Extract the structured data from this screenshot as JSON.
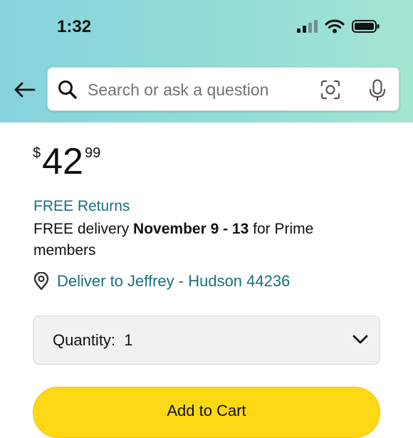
{
  "status_bar": {
    "time": "1:32"
  },
  "header": {
    "search": {
      "placeholder": "Search or ask a question"
    }
  },
  "product": {
    "price": {
      "symbol": "$",
      "whole": "42",
      "fraction": "99"
    },
    "free_returns": "FREE Returns",
    "delivery": {
      "prefix": "FREE delivery ",
      "dates": "November 9 - 13",
      "suffix": " for Prime members"
    },
    "deliver_to": "Deliver to Jeffrey - Hudson 44236",
    "quantity": {
      "label": "Quantity:",
      "value": "1"
    },
    "add_to_cart": "Add to Cart"
  },
  "icons": {
    "back": "back-arrow-icon",
    "search": "search-icon",
    "camera": "camera-lens-icon",
    "mic": "microphone-icon",
    "location": "location-pin-icon",
    "chevron": "chevron-down-icon"
  },
  "colors": {
    "link": "#16707d",
    "cart_button": "#ffd814",
    "header_gradient_start": "#86d3dd",
    "header_gradient_end": "#a4e5d2"
  }
}
